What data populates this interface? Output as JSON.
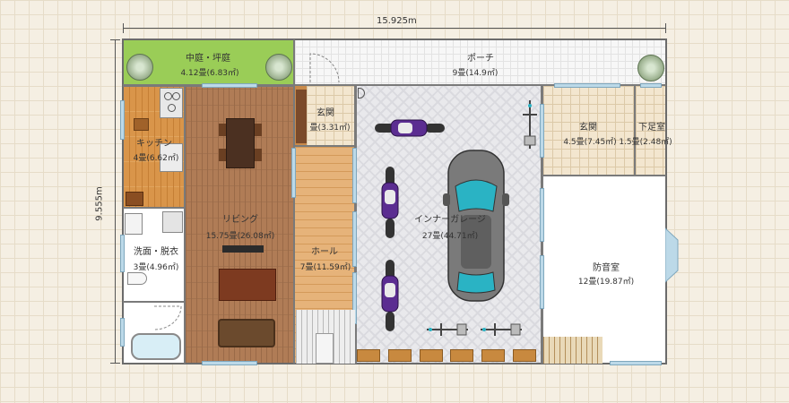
{
  "dimensions": {
    "width_label": "15.925m",
    "height_label": "9.555m"
  },
  "rooms": {
    "courtyard": {
      "name": "中庭・坪庭",
      "area": "4.12畳(6.83㎡)"
    },
    "porch": {
      "name": "ポーチ",
      "area": "9畳(14.9㎡)"
    },
    "entrance_small": {
      "name": "玄関",
      "area": "畳(3.31㎡)"
    },
    "kitchen": {
      "name": "キッチン",
      "area": "4畳(6.62㎡)"
    },
    "living": {
      "name": "リビング",
      "area": "15.75畳(26.08㎡)"
    },
    "washroom": {
      "name": "洗面・脱衣",
      "area": "3畳(4.96㎡)"
    },
    "hall": {
      "name": "ホール",
      "area": "7畳(11.59㎡)"
    },
    "garage": {
      "name": "インナーガレージ",
      "area": "27畳(44.71㎡)"
    },
    "entrance_big": {
      "name": "玄関",
      "area": "4.5畳(7.45㎡)"
    },
    "shoe_room": {
      "name": "下足室",
      "area": "1.5畳(2.48㎡)"
    },
    "soundproof": {
      "name": "防音室",
      "area": "12畳(19.87㎡)"
    }
  },
  "colors": {
    "grass": "#9acd57",
    "wood": "#d9954a",
    "wall": "#7a7a7a",
    "motorcycle": "#5b2d91",
    "car": "#7a7a7a",
    "glass": "#2ab3c4"
  }
}
